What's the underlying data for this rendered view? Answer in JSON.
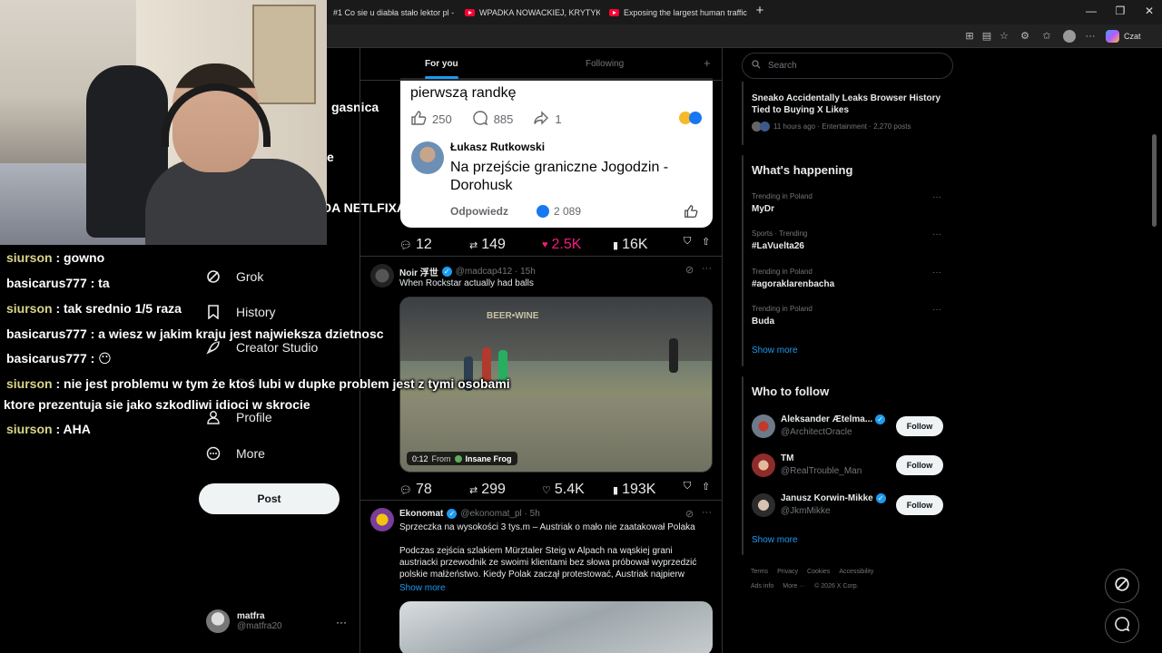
{
  "browser": {
    "tabs": [
      {
        "title": "#1 Co sie u diabła stało lektor pl -",
        "icon": "youtube-icon"
      },
      {
        "title": "WPADKA NOWACKIEJ, KRYTYKA T",
        "icon": "youtube-icon"
      },
      {
        "title": "Exposing the largest human traffic",
        "icon": "youtube-icon"
      }
    ],
    "new_tab": "+",
    "window_controls": [
      "—",
      "❐",
      "✕"
    ],
    "copilot_label": "Czat"
  },
  "left_fragments": {
    "gasnica": "gasnica",
    "e": "e",
    "netflixa": "DA NETLFIXA"
  },
  "nav": {
    "items": [
      {
        "label": "Grok",
        "icon": "grok-icon"
      },
      {
        "label": "History",
        "icon": "bookmark-icon"
      },
      {
        "label": "Creator Studio",
        "icon": "rocket-icon"
      },
      {
        "label": "Profile",
        "icon": "person-icon"
      },
      {
        "label": "More",
        "icon": "more-circle-icon"
      }
    ],
    "hidden_partial": "Grok",
    "post_button": "Post",
    "account": {
      "name": "matfra",
      "handle": "@matfra20",
      "more": "···"
    }
  },
  "timeline": {
    "tabs": [
      {
        "label": "For you",
        "active": true
      },
      {
        "label": "Following",
        "active": false
      }
    ],
    "add_tab": "+",
    "fb_card": {
      "text_top": "pierwszą randkę",
      "likes": "250",
      "comments": "885",
      "shares": "1",
      "commenter": "Łukasz Rutkowski",
      "comment": "Na przejście graniczne Jogodzin - Dorohusk",
      "reply": "Odpowiedz",
      "comment_likes": "2 089"
    },
    "tweet1_actions": {
      "replies": "12",
      "reposts": "149",
      "likes": "2.5K",
      "views": "16K"
    },
    "tweet2": {
      "name": "Noir 浮世",
      "handle": "@madcap412 · 15h",
      "text": "When Rockstar actually had balls",
      "video_sign": "BEER•WINE",
      "video_time": "0:12",
      "video_from": "From",
      "video_source": "Insane Frog",
      "replies": "78",
      "reposts": "299",
      "likes": "5.4K",
      "views": "193K"
    },
    "tweet3": {
      "name": "Ekonomat",
      "handle": "@ekonomat_pl · 5h",
      "text1": "Sprzeczka na wysokości 3 tys.m – Austriak o mało nie zaatakował Polaka",
      "text2": "Podczas zejścia szlakiem Mürztaler Steig w Alpach na wąskiej grani austriacki przewodnik ze swoimi klientami bez słowa próbował wyprzedzić polskie małżeństwo. Kiedy Polak zaczął protestować, Austriak najpierw",
      "show_more": "Show more"
    }
  },
  "right": {
    "search_placeholder": "Search",
    "news": {
      "title": "Sneako Accidentally Leaks Browser History Tied to Buying X Likes",
      "meta": "11 hours ago · Entertainment · 2,270 posts"
    },
    "whats_happening": "What's happening",
    "trends": [
      {
        "category": "Trending in Poland",
        "name": "MyDr"
      },
      {
        "category": "Sports · Trending",
        "name": "#LaVuelta26"
      },
      {
        "category": "Trending in Poland",
        "name": "#agoraklarenbacha"
      },
      {
        "category": "Trending in Poland",
        "name": "Buda"
      }
    ],
    "trend_more": "···",
    "show_more": "Show more",
    "who_to_follow": "Who to follow",
    "follow": [
      {
        "name": "Aleksander Ætelma...",
        "handle": "@ArchitectOracle",
        "button": "Follow"
      },
      {
        "name": "TM",
        "handle": "@RealTrouble_Man",
        "button": "Follow"
      },
      {
        "name": "Janusz Korwin-Mikke",
        "handle": "@JkmMikke",
        "button": "Follow"
      }
    ],
    "footer1": [
      "Terms",
      "Privacy",
      "Cookies",
      "Accessibility"
    ],
    "footer2": [
      "Ads info",
      "More ···",
      "© 2026 X Corp."
    ]
  },
  "chat": {
    "lines": [
      {
        "user": "siurson",
        "text": " : gowno"
      },
      {
        "user": "basicarus777",
        "text": " : ta"
      },
      {
        "user": "siurson",
        "text": " : tak srednio 1/5 raza"
      },
      {
        "user": "basicarus777",
        "text": " : a wiesz w jakim kraju jest najwieksza dzietnosc"
      },
      {
        "user": "basicarus777",
        "text": " : 😶"
      },
      {
        "user": "siurson",
        "text": " : nie jest problemu w tym że ktoś lubi w dupke problem jest z tymi osobami"
      },
      {
        "user": "",
        "text": "ktore prezentuja sie jako szkodliwi idioci w skrocie"
      },
      {
        "user": "siurson",
        "text": " : AHA"
      }
    ]
  },
  "colors": {
    "accent": "#1d9bf0",
    "background": "#000000",
    "like": "#f91880",
    "chat_user_siurson": "#d9d58a"
  }
}
